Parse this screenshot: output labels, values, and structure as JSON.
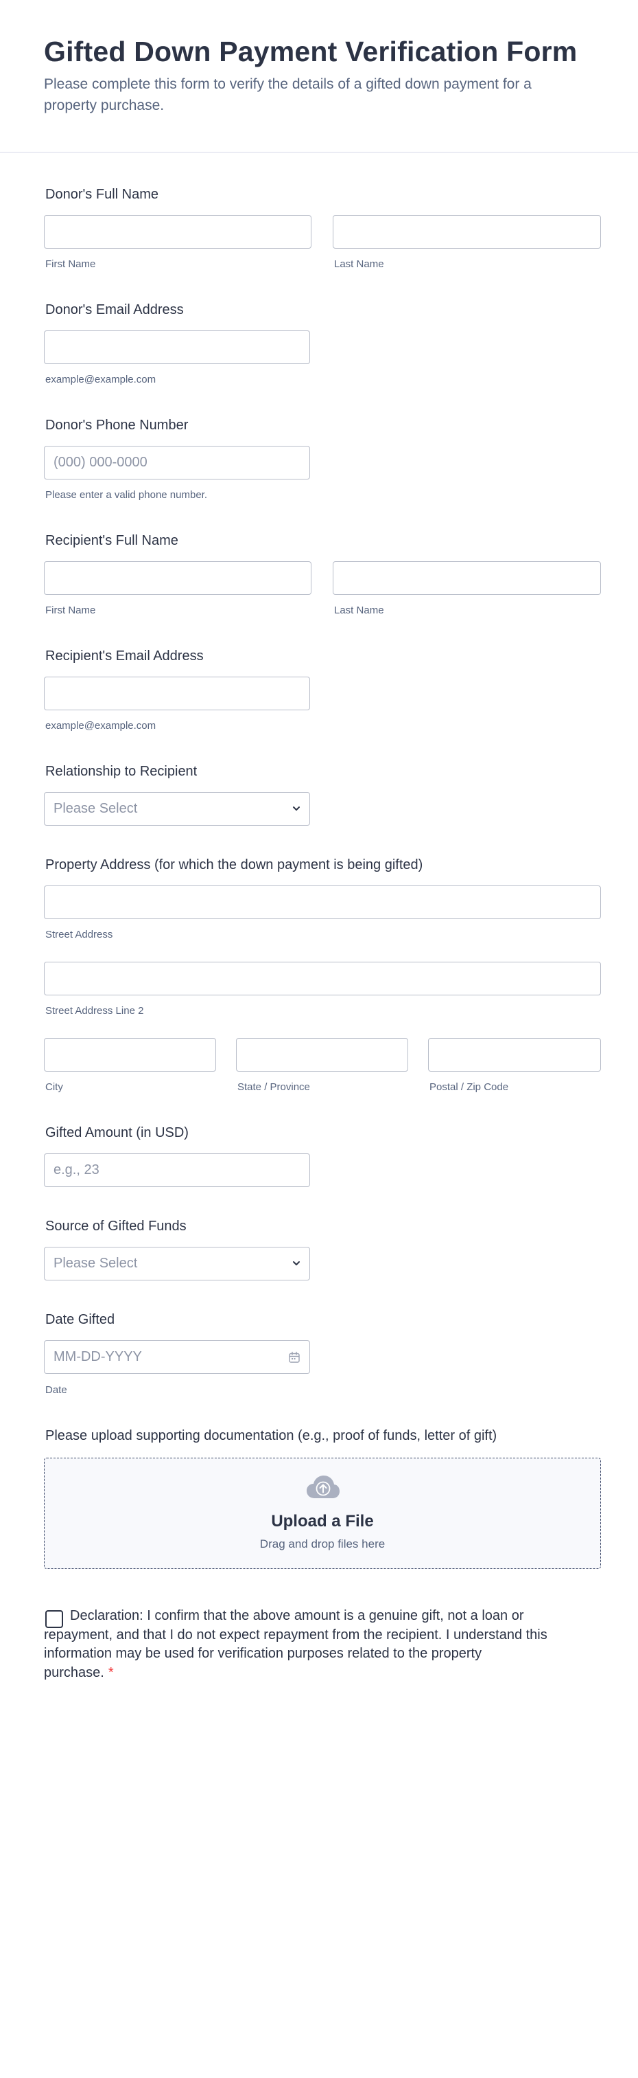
{
  "form": {
    "title": "Gifted Down Payment Verification Form",
    "subtitle": "Please complete this form to verify the details of a gifted down payment for a property purchase."
  },
  "donor_name": {
    "label": "Donor's Full Name",
    "first_sub": "First Name",
    "last_sub": "Last Name"
  },
  "donor_email": {
    "label": "Donor's Email Address",
    "sub": "example@example.com"
  },
  "donor_phone": {
    "label": "Donor's Phone Number",
    "placeholder": "(000) 000-0000",
    "sub": "Please enter a valid phone number."
  },
  "recipient_name": {
    "label": "Recipient's Full Name",
    "first_sub": "First Name",
    "last_sub": "Last Name"
  },
  "recipient_email": {
    "label": "Recipient's Email Address",
    "sub": "example@example.com"
  },
  "relationship": {
    "label": "Relationship to Recipient",
    "placeholder": "Please Select"
  },
  "address": {
    "label": "Property Address (for which the down payment is being gifted)",
    "street_sub": "Street Address",
    "street2_sub": "Street Address Line 2",
    "city_sub": "City",
    "state_sub": "State / Province",
    "zip_sub": "Postal / Zip Code"
  },
  "amount": {
    "label": "Gifted Amount (in USD)",
    "placeholder": "e.g., 23"
  },
  "source": {
    "label": "Source of Gifted Funds",
    "placeholder": "Please Select"
  },
  "date": {
    "label": "Date Gifted",
    "placeholder": "MM-DD-YYYY",
    "sub": "Date"
  },
  "upload": {
    "label": "Please upload supporting documentation (e.g., proof of funds, letter of gift)",
    "title": "Upload a File",
    "sub": "Drag and drop files here"
  },
  "declaration": {
    "text": "Declaration: I confirm that the above amount is a genuine gift, not a loan or repayment, and that I do not expect repayment from the recipient. I understand this information may be used for verification purposes related to the property purchase.",
    "required_mark": "*"
  },
  "colors": {
    "text": "#2c3345",
    "muted": "#57647e",
    "border": "#b8bdc9",
    "required": "#f23a3c"
  }
}
